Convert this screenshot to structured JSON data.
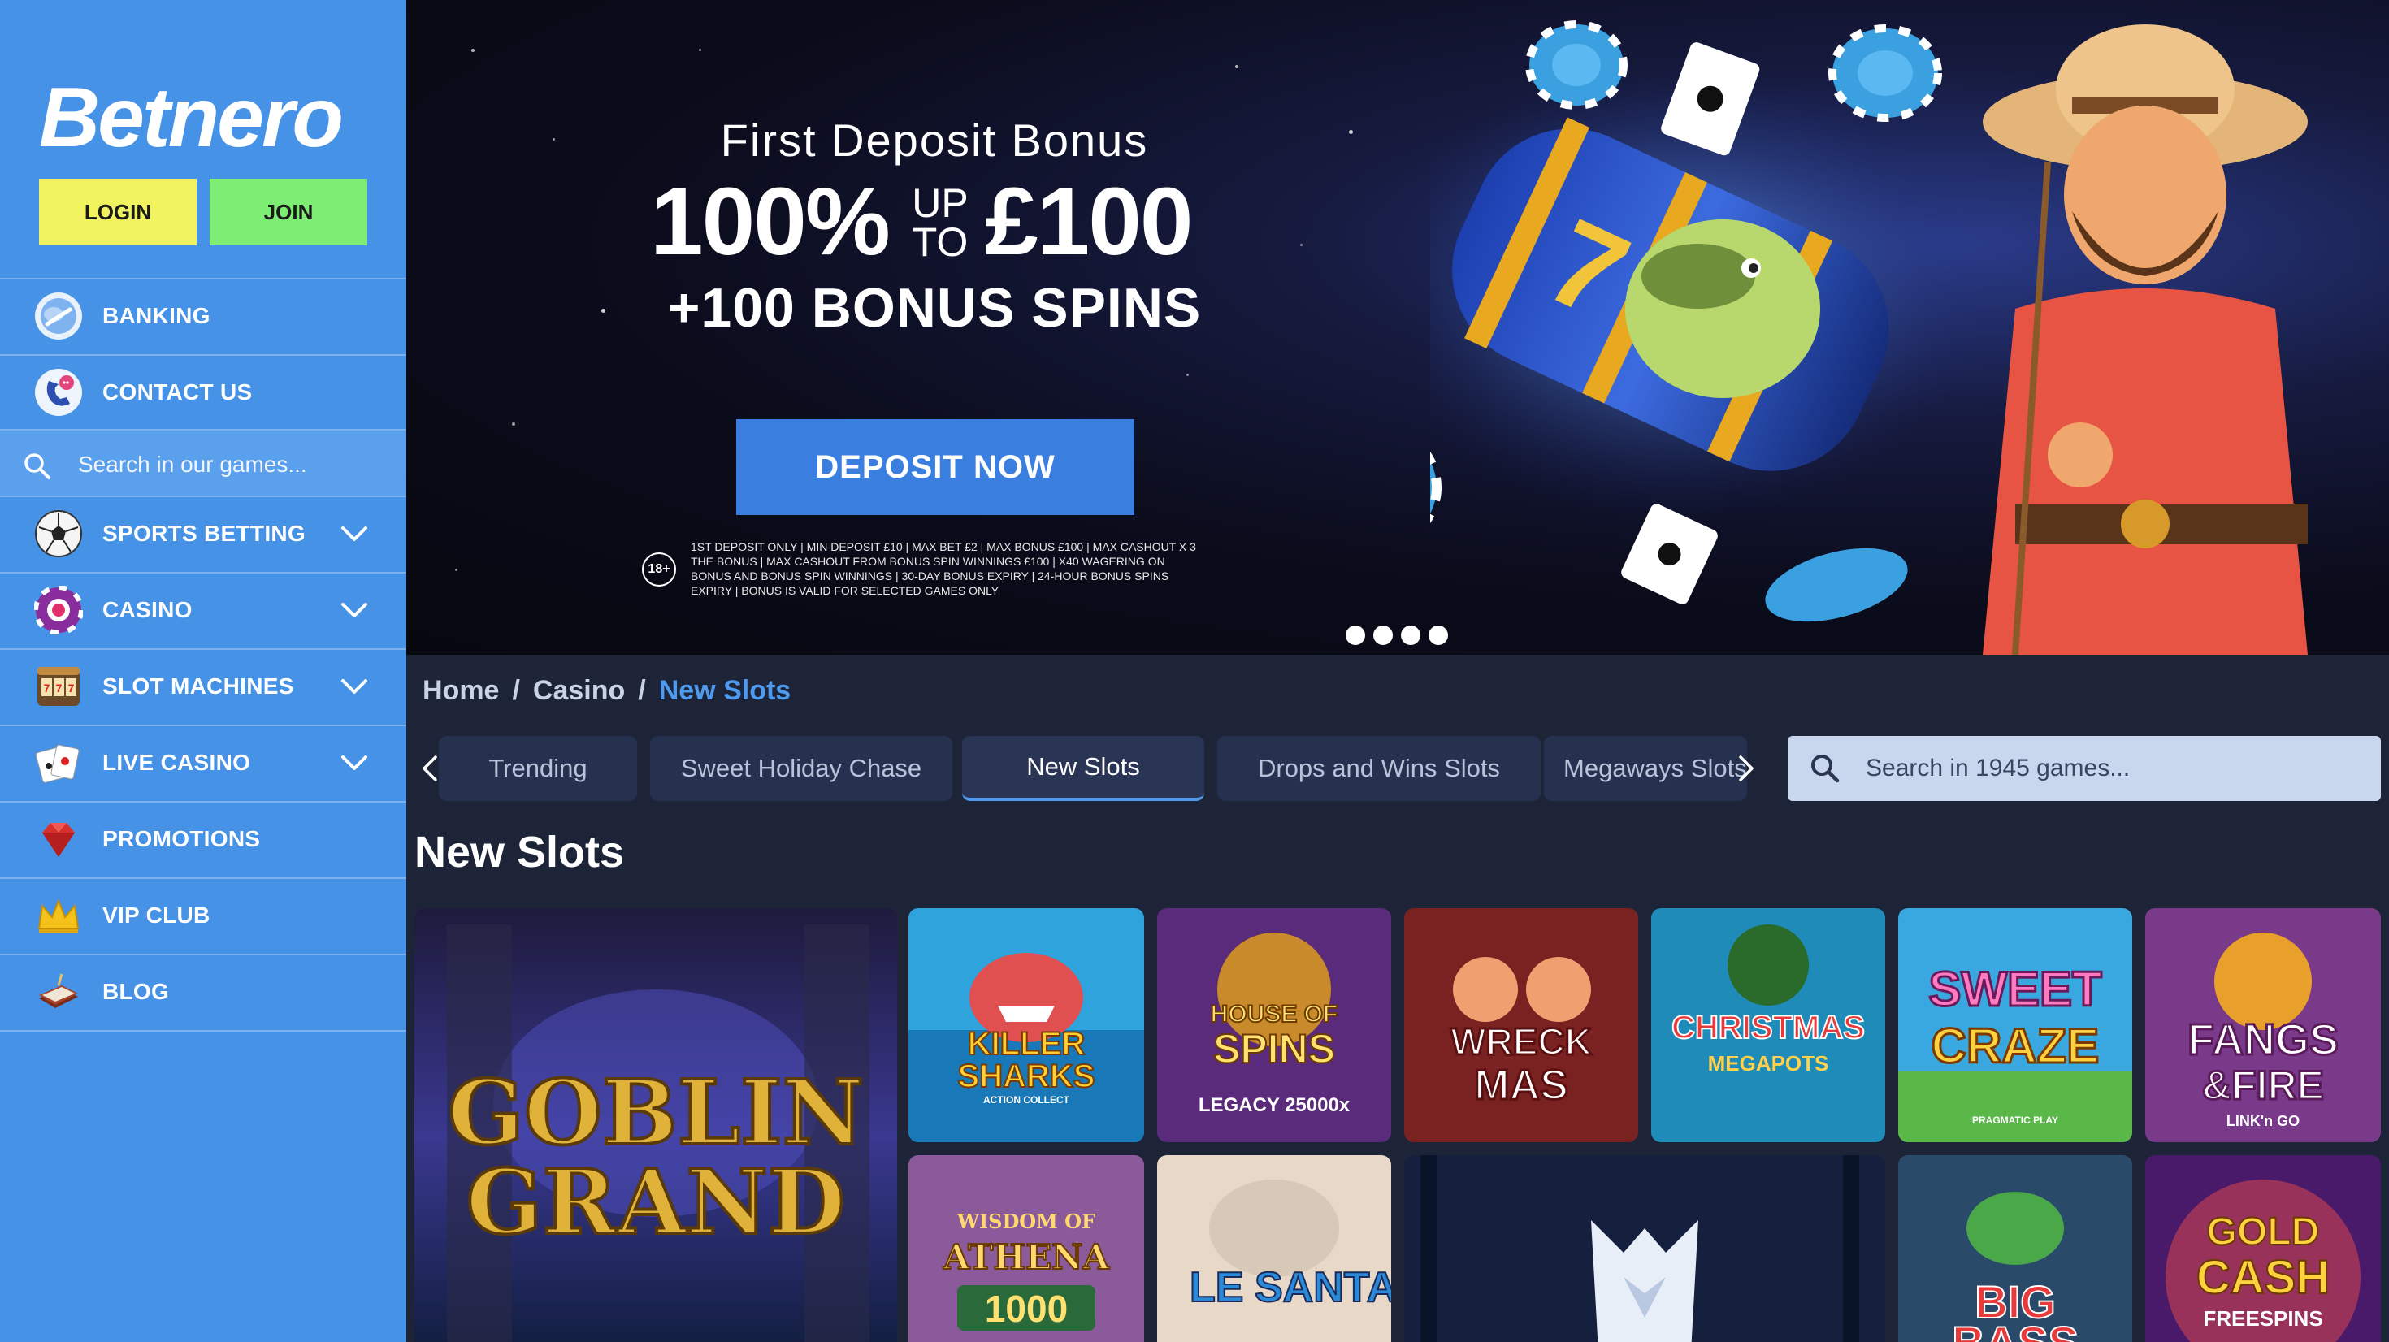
{
  "brand": {
    "logo_text": "Betnero"
  },
  "auth": {
    "login_label": "LOGIN",
    "join_label": "JOIN"
  },
  "sidebar": {
    "items": [
      {
        "label": "BANKING",
        "icon": "banking-icon"
      },
      {
        "label": "CONTACT US",
        "icon": "contact-icon"
      },
      {
        "label": "SPORTS BETTING",
        "icon": "football-icon",
        "expandable": true
      },
      {
        "label": "CASINO",
        "icon": "casino-chip-icon",
        "expandable": true
      },
      {
        "label": "SLOT MACHINES",
        "icon": "slot-machine-icon",
        "expandable": true
      },
      {
        "label": "LIVE CASINO",
        "icon": "playing-cards-icon",
        "expandable": true
      },
      {
        "label": "PROMOTIONS",
        "icon": "diamond-icon"
      },
      {
        "label": "VIP CLUB",
        "icon": "crown-icon"
      },
      {
        "label": "BLOG",
        "icon": "book-icon"
      }
    ],
    "search_placeholder": "Search in our games..."
  },
  "banner": {
    "subtitle": "First Deposit Bonus",
    "amount_pct": "100%",
    "up_to_line1": "UP",
    "up_to_line2": "TO",
    "amount_value": "£100",
    "spins": "+100 BONUS SPINS",
    "cta": "DEPOSIT NOW",
    "age": "18+",
    "terms": "1ST DEPOSIT ONLY | MIN DEPOSIT £10 | MAX BET £2 | MAX BONUS £100 | MAX CASHOUT X 3 THE BONUS | MAX CASHOUT FROM BONUS SPIN WINNINGS £100 | X40 WAGERING ON BONUS AND BONUS SPIN WINNINGS | 30-DAY BONUS EXPIRY | 24-HOUR BONUS SPINS EXPIRY | BONUS IS VALID FOR SELECTED GAMES ONLY",
    "slides": 4,
    "active_slide": 1
  },
  "breadcrumb": {
    "items": [
      "Home",
      "Casino",
      "New Slots"
    ],
    "separator": "/"
  },
  "tabs": [
    "Trending",
    "Sweet Holiday Chase",
    "New Slots",
    "Drops and Wins Slots",
    "Megaways Slots"
  ],
  "active_tab": "New Slots",
  "search": {
    "placeholder": "Search in 1945 games..."
  },
  "section": {
    "title": "New Slots"
  },
  "games": [
    {
      "title_line1": "GOBLIN",
      "title_line2": "GRAND"
    },
    {
      "title_line1": "KILLER",
      "title_line2": "SHARKS",
      "sub": "ACTION COLLECT"
    },
    {
      "title_line1": "HOUSE OF",
      "title_line2": "SPINS",
      "sub": "LEGACY 25000x"
    },
    {
      "title_line1": "WRECK",
      "title_line2": "MAS"
    },
    {
      "title_line1": "CHRISTMAS",
      "title_line2": "MEGAPOTS"
    },
    {
      "title_line1": "SWEET",
      "title_line2": "CRAZE",
      "sub": "PRAGMATIC PLAY"
    },
    {
      "title_line1": "FANGS",
      "title_line2": "&FIRE",
      "sub": "LINK'n GO"
    },
    {
      "title_line1": "WISDOM OF",
      "title_line2": "ATHENA",
      "sub": "1000"
    },
    {
      "title_line1": "LE",
      "title_line2": "SANTA"
    },
    {
      "title_line1": "",
      "title_line2": ""
    },
    {
      "title_line1": "BIG",
      "title_line2": "BASS"
    },
    {
      "title_line1": "GOLD",
      "title_line2": "CASH",
      "sub": "FREESPINS"
    }
  ],
  "colors": {
    "sidebar_bg": "#4592e6",
    "login_btn": "#f0f25f",
    "join_btn": "#7ded73",
    "page_bg": "#1d2438",
    "accent": "#4d9aef",
    "cta": "#3a7fe0"
  }
}
